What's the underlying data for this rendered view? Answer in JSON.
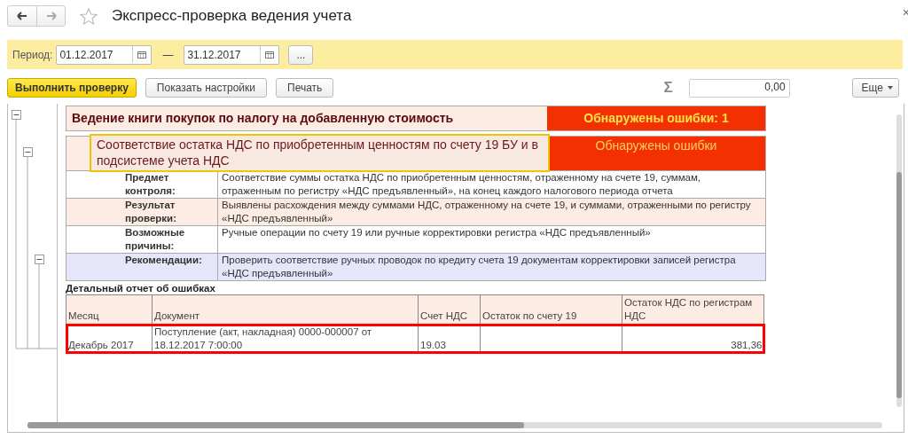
{
  "window": {
    "title": "Экспресс-проверка ведения учета",
    "close": "×"
  },
  "period": {
    "label": "Период:",
    "from": "01.12.2017",
    "separator": "—",
    "to": "31.12.2017",
    "more_button": "..."
  },
  "toolbar": {
    "buttons": [
      {
        "label": "Выполнить проверку",
        "kind": "primary"
      },
      {
        "label": "Показать настройки",
        "kind": "normal"
      },
      {
        "label": "Печать",
        "kind": "normal"
      }
    ],
    "sum_symbol": "Σ",
    "sum_value": "0,00",
    "more": "Еще"
  },
  "outline": [
    {
      "expanded": true,
      "children": [
        {
          "expanded": true,
          "children": [
            {
              "expanded": true
            }
          ]
        }
      ]
    }
  ],
  "report": {
    "section": {
      "title": "Ведение книги покупок по налогу на добавленную стоимость",
      "status": "Обнаружены ошибки: 1"
    },
    "check": {
      "title": "Соответствие остатка НДС по приобретенным ценностям по счету 19 БУ и в подсистеме учета НДС",
      "status": "Обнаружены ошибки",
      "focused": true
    },
    "details": [
      {
        "kind": "plain",
        "label": "Предмет контроля:",
        "text": "Соответствие суммы остатка НДС по приобретенным ценностям, отраженному на счете 19, суммам, отраженным по регистру «НДС предъявленный», на конец каждого налогового периода отчета"
      },
      {
        "kind": "result",
        "label": "Результат проверки:",
        "text": "Выявлены расхождения между суммами НДС, отраженному на счете 19, и суммами, отраженными по регистру «НДС предъявленный»"
      },
      {
        "kind": "plain",
        "label": "Возможные причины:",
        "text": "Ручные операции по счету 19 или ручные корректировки регистра «НДС предъявленный»"
      },
      {
        "kind": "recommendation",
        "label": "Рекомендации:",
        "text": "Проверить соответствие ручных проводок по кредиту счета 19 документам корректировки записей регистра «НДС предъявленный»"
      }
    ],
    "error_report": {
      "title": "Детальный отчет об ошибках",
      "columns": [
        "Месяц",
        "Документ",
        "Счет НДС",
        "Остаток по счету 19",
        "Остаток НДС по регистрам НДС"
      ],
      "rows": [
        {
          "highlighted": true,
          "cells": [
            "Декабрь 2017",
            "Поступление (акт, накладная) 0000-000007 от 18.12.2017 7:00:00",
            "19.03",
            "",
            "381,36"
          ]
        }
      ]
    }
  }
}
